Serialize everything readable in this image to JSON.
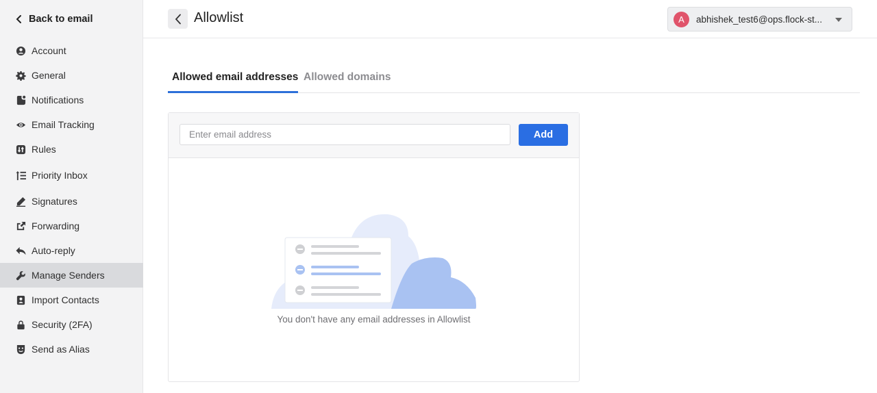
{
  "sidebar": {
    "back_label": "Back to email",
    "items": [
      {
        "label": "Account",
        "icon": "account-icon"
      },
      {
        "label": "General",
        "icon": "gear-icon"
      },
      {
        "label": "Notifications",
        "icon": "notification-icon"
      },
      {
        "label": "Email Tracking",
        "icon": "eye-icon"
      },
      {
        "label": "Rules",
        "icon": "rules-icon"
      },
      {
        "label": "Priority Inbox",
        "icon": "priority-list-icon"
      },
      {
        "label": "Signatures",
        "icon": "pen-icon"
      },
      {
        "label": "Forwarding",
        "icon": "forward-icon"
      },
      {
        "label": "Auto-reply",
        "icon": "reply-icon"
      },
      {
        "label": "Manage Senders",
        "icon": "wrench-icon",
        "active": true
      },
      {
        "label": "Import Contacts",
        "icon": "contact-icon"
      },
      {
        "label": "Security (2FA)",
        "icon": "lock-icon"
      },
      {
        "label": "Send as Alias",
        "icon": "alias-mask-icon"
      }
    ]
  },
  "header": {
    "title": "Allowlist",
    "account": {
      "avatar_letter": "A",
      "email": "abhishek_test6@ops.flock-st...",
      "avatar_color": "#e0546b"
    }
  },
  "tabs": [
    {
      "label": "Allowed email addresses",
      "active": true
    },
    {
      "label": "Allowed domains",
      "active": false
    }
  ],
  "form": {
    "placeholder": "Enter email address",
    "value": "",
    "add_label": "Add"
  },
  "empty_state": {
    "message": "You don't have any email addresses in Allowlist"
  },
  "colors": {
    "accent": "#2a6ee3",
    "tab_underline": "#2c6fd9",
    "active_nav_bg": "#d9dadd"
  }
}
